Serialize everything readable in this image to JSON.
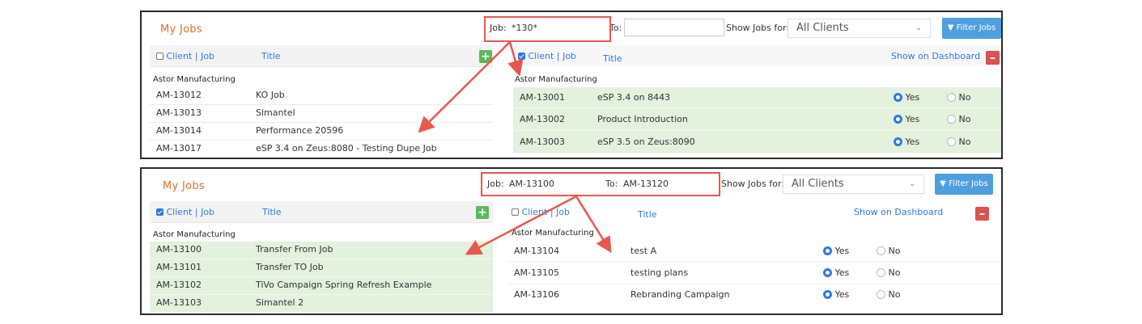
{
  "colors": {
    "accent": "#e0702c",
    "link": "#2a7ae2",
    "row_highlight": "#e3f1dd",
    "annotation": "#e8574c",
    "add": "#5cb85c",
    "remove": "#d9534f",
    "filter": "#4d9fe0"
  },
  "panel1": {
    "title": "My Jobs",
    "left": {
      "header": {
        "client_label": "Client",
        "sep": "|",
        "job_label": "Job",
        "title_label": "Title",
        "checked": false
      },
      "group": "Astor Manufacturing",
      "rows": [
        {
          "job": "AM-13012",
          "title": "KO Job"
        },
        {
          "job": "AM-13013",
          "title": "Simantel"
        },
        {
          "job": "AM-13014",
          "title": "Performance 20596"
        },
        {
          "job": "AM-13017",
          "title": "eSP 3.4 on Zeus:8080 - Testing Dupe Job"
        }
      ],
      "add_icon": "plus-icon"
    },
    "filters": {
      "job_label": "Job:",
      "job_value": "*130*",
      "to_label": "To:",
      "to_value": "",
      "show_for_label": "Show Jobs for:",
      "show_for_value": "All Clients",
      "filter_button": "Filter Jobs"
    },
    "right": {
      "header": {
        "client_label": "Client",
        "sep": "|",
        "job_label": "Job",
        "title_label": "Title",
        "dashboard_label": "Show on Dashboard",
        "checked": true
      },
      "group": "Astor Manufacturing",
      "rows": [
        {
          "job": "AM-13001",
          "title": "eSP 3.4 on 8443",
          "yes": "Yes",
          "no": "No"
        },
        {
          "job": "AM-13002",
          "title": "Product Introduction",
          "yes": "Yes",
          "no": "No"
        },
        {
          "job": "AM-13003",
          "title": "eSP 3.5 on Zeus:8090",
          "yes": "Yes",
          "no": "No"
        }
      ],
      "remove_icon": "minus-icon"
    }
  },
  "panel2": {
    "title": "My Jobs",
    "left": {
      "header": {
        "client_label": "Client",
        "sep": "|",
        "job_label": "Job",
        "title_label": "Title",
        "checked": true
      },
      "group": "Astor Manufacturing",
      "rows": [
        {
          "job": "AM-13100",
          "title": "Transfer From Job"
        },
        {
          "job": "AM-13101",
          "title": "Transfer TO Job"
        },
        {
          "job": "AM-13102",
          "title": "TiVo Campaign Spring Refresh Example"
        },
        {
          "job": "AM-13103",
          "title": "Simantel 2"
        }
      ],
      "add_icon": "plus-icon"
    },
    "filters": {
      "job_label": "Job:",
      "job_value": "AM-13100",
      "to_label": "To:",
      "to_value": "AM-13120",
      "show_for_label": "Show Jobs for:",
      "show_for_value": "All Clients",
      "filter_button": "Filter Jobs"
    },
    "right": {
      "header": {
        "client_label": "Client",
        "sep": "|",
        "job_label": "Job",
        "title_label": "Title",
        "dashboard_label": "Show on Dashboard",
        "checked": false
      },
      "group": "Astor Manufacturing",
      "rows": [
        {
          "job": "AM-13104",
          "title": "test A",
          "yes": "Yes",
          "no": "No"
        },
        {
          "job": "AM-13105",
          "title": "testing plans",
          "yes": "Yes",
          "no": "No"
        },
        {
          "job": "AM-13106",
          "title": "Rebranding Campaign",
          "yes": "Yes",
          "no": "No"
        }
      ],
      "remove_icon": "minus-icon"
    }
  }
}
